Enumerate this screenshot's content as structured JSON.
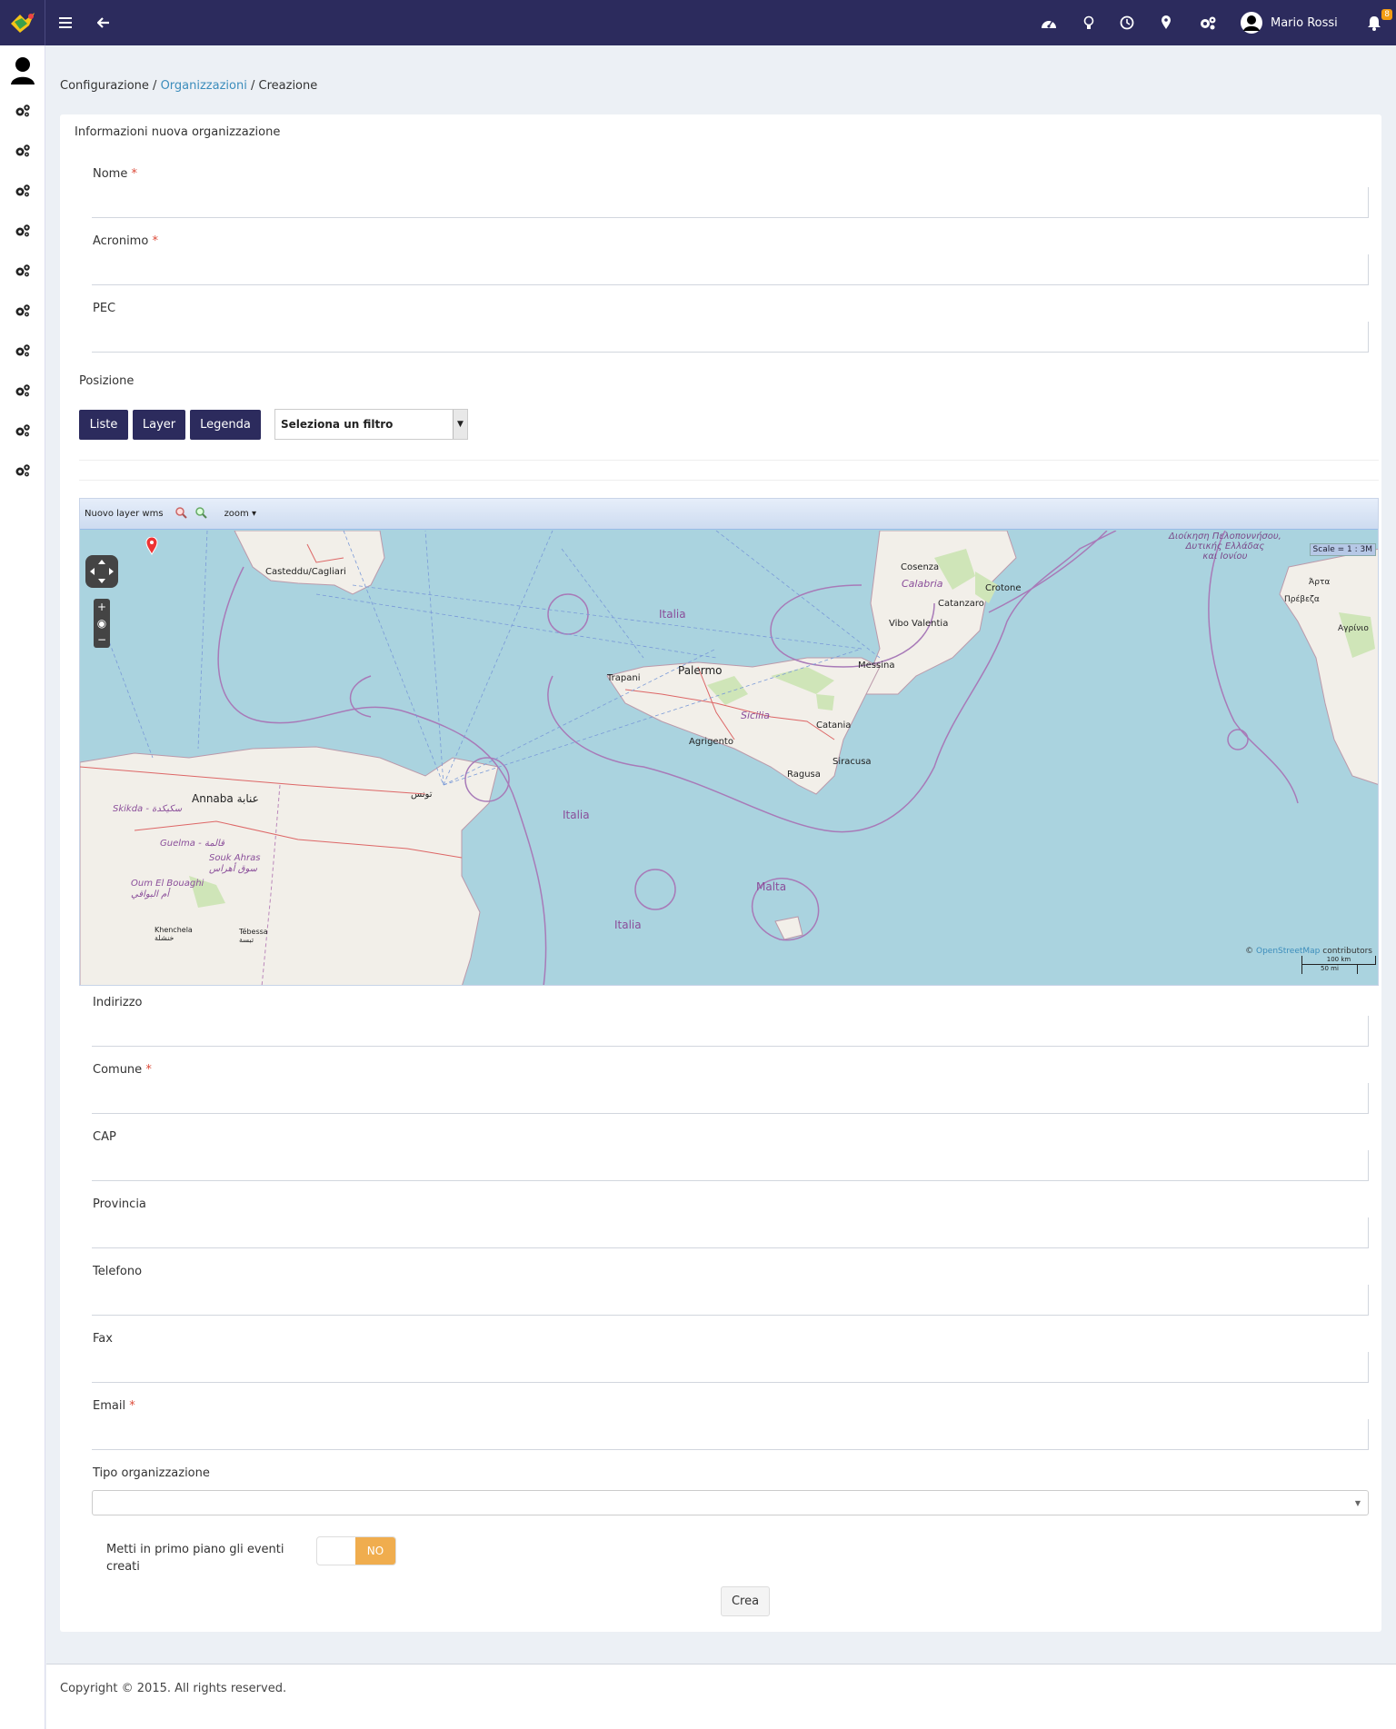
{
  "topbar": {
    "user_name": "Mario Rossi",
    "notification_count": "8",
    "icons": [
      "menu-icon",
      "back-arrow-icon",
      "dashboard-icon",
      "lightbulb-icon",
      "clock-icon",
      "map-marker-icon",
      "gears-icon",
      "user-avatar-icon",
      "bell-icon"
    ]
  },
  "sidebar": {
    "items": [
      "user-icon",
      "gears-icon",
      "gears-icon",
      "gears-icon",
      "gears-icon",
      "gears-icon",
      "gears-icon",
      "gears-icon",
      "gears-icon",
      "gears-icon",
      "gears-icon"
    ]
  },
  "breadcrumb": {
    "root": "Configurazione",
    "sep": "/",
    "link": "Organizzazioni",
    "current": "Creazione"
  },
  "card": {
    "title": "Informazioni nuova organizzazione"
  },
  "fields": {
    "nome": {
      "label": "Nome",
      "required": "*",
      "value": ""
    },
    "acronimo": {
      "label": "Acronimo",
      "required": "*",
      "value": ""
    },
    "pec": {
      "label": "PEC",
      "value": ""
    },
    "indirizzo": {
      "label": "Indirizzo",
      "value": ""
    },
    "comune": {
      "label": "Comune",
      "required": "*",
      "value": ""
    },
    "cap": {
      "label": "CAP",
      "value": ""
    },
    "provincia": {
      "label": "Provincia",
      "value": ""
    },
    "telefono": {
      "label": "Telefono",
      "value": ""
    },
    "fax": {
      "label": "Fax",
      "value": ""
    },
    "email": {
      "label": "Email",
      "required": "*",
      "value": ""
    },
    "tipo": {
      "label": "Tipo organizzazione",
      "value": ""
    }
  },
  "position": {
    "label": "Posizione",
    "buttons": {
      "liste": "Liste",
      "layer": "Layer",
      "legenda": "Legenda"
    },
    "filter_placeholder": "Seleziona un filtro"
  },
  "map": {
    "toolbar": {
      "new_layer": "Nuovo layer wms",
      "zoom": "zoom"
    },
    "scale_text": "Scale = 1 : 3M",
    "scale_km": "100 km",
    "scale_mi": "50 mi",
    "attribution_prefix": "©",
    "attribution_link": "OpenStreetMap",
    "attribution_suffix": "contributors",
    "labels": {
      "casteddu": "Casteddu/Cagliari",
      "cosenza": "Cosenza",
      "calabria": "Calabria",
      "crotone": "Crotone",
      "catanzaro": "Catanzaro",
      "vibo": "Vibo Valentia",
      "messina": "Messina",
      "palermo": "Palermo",
      "trapani": "Trapani",
      "sicilia": "Sicilia",
      "catania": "Catania",
      "agrigento": "Agrigento",
      "siracusa": "Siracusa",
      "ragusa": "Ragusa",
      "italia1": "Italia",
      "italia2": "Italia",
      "italia3": "Italia",
      "malta": "Malta",
      "annaba": "Annaba عنابة",
      "skikda": "Skikda - سكيكدة",
      "guelma": "Guelma - قالمة",
      "souk_ahras": "Souk Ahras\nسوق أهراس",
      "oum": "Oum El Bouaghi\nأم البواقي",
      "khenchela": "Khenchela\nخنشلة",
      "tebessa": "Tébessa\nتبسة",
      "tunis": "تونس",
      "greek1": "Διοίκηση Πελοποννήσου,\nΔυτικής Ελλάδας\nκαι Ιονίου",
      "arta": "Άρτα",
      "preveza": "Πρέβεζα",
      "agrinio": "Αγρίνιο"
    }
  },
  "toggle": {
    "label": "Metti in primo piano gli eventi creati",
    "state": "NO"
  },
  "submit_label": "Crea",
  "footer": "Copyright © 2015. All rights reserved.",
  "colors": {
    "topbar": "#2c2b5d",
    "accent_link": "#3c8dbc",
    "required": "#dd4b39",
    "toggle_no": "#f0ad4e",
    "sea": "#aad3df",
    "land": "#f2efe9"
  }
}
